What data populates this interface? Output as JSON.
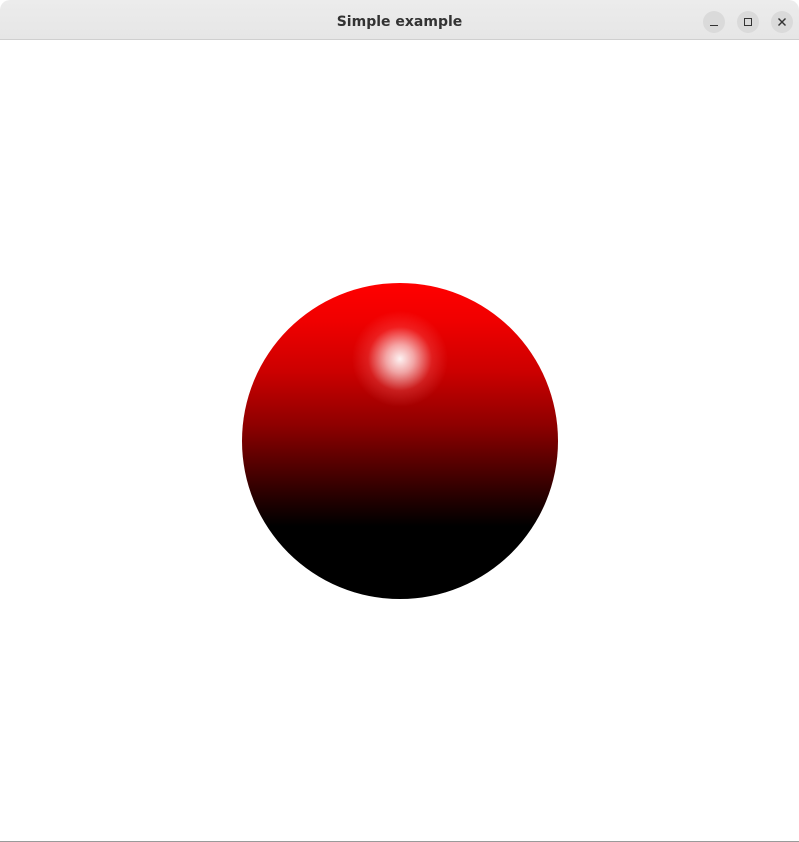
{
  "window": {
    "title": "Simple example",
    "controls": {
      "minimize": "minimize-icon",
      "maximize": "maximize-icon",
      "close": "close-icon"
    }
  },
  "scene": {
    "object": "sphere",
    "color": "#ff0000",
    "background": "#ffffff",
    "highlight_color": "#ffffff"
  }
}
